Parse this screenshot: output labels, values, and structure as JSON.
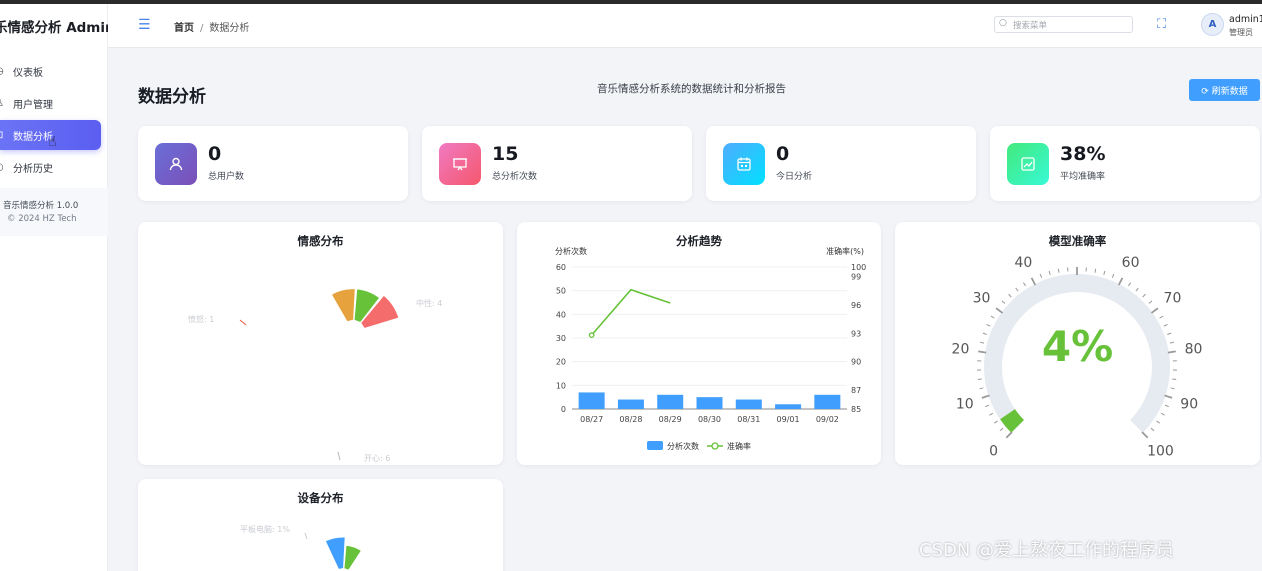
{
  "sidebar": {
    "brand": "乐情感分析 Admin",
    "items": [
      {
        "label": "仪表板",
        "icon": "dashboard-icon"
      },
      {
        "label": "用户管理",
        "icon": "user-icon"
      },
      {
        "label": "数据分析",
        "icon": "data-analysis-icon",
        "active": true
      },
      {
        "label": "分析历史",
        "icon": "history-icon"
      }
    ],
    "version": "音乐情感分析 1.0.0",
    "copyright": "© 2024 HZ Tech"
  },
  "header": {
    "breadcrumb_home": "首页",
    "breadcrumb_sep": "/",
    "breadcrumb_current": "数据分析",
    "search_placeholder": "搜索菜单",
    "user_name": "admin1",
    "user_role": "管理员",
    "avatar_letter": "A"
  },
  "page": {
    "title": "数据分析",
    "subtitle": "音乐情感分析系统的数据统计和分析报告",
    "refresh_label": "⟳ 刷新数据"
  },
  "stats": [
    {
      "value": "0",
      "label": "总用户数",
      "icon": "user-icon",
      "color_a": "#6a6fd8",
      "color_b": "#7b4fb8"
    },
    {
      "value": "15",
      "label": "总分析次数",
      "icon": "presentation-icon",
      "color_a": "#f07ac2",
      "color_b": "#f5576c"
    },
    {
      "value": "0",
      "label": "今日分析",
      "icon": "calendar-icon",
      "color_a": "#4facfe",
      "color_b": "#00e0fe"
    },
    {
      "value": "38%",
      "label": "平均准确率",
      "icon": "trend-icon",
      "color_a": "#43e97b",
      "color_b": "#38f9d7"
    }
  ],
  "panels": {
    "emotion": {
      "title": "情感分布",
      "ghost_labels": [
        "愤怒: 1",
        "中性: 4",
        "开心: 6"
      ]
    },
    "trend": {
      "title": "分析趋势"
    },
    "gauge": {
      "title": "模型准确率",
      "display": "4%"
    },
    "device": {
      "title": "设备分布",
      "ghost_labels": [
        "平板电脑: 1%"
      ]
    }
  },
  "chart_data": [
    {
      "type": "pie",
      "title": "情感分布",
      "slices": [
        {
          "name": "愤怒",
          "value": 1,
          "color": "#e8563c"
        },
        {
          "name": "中性",
          "value": 4,
          "color": "#67c23a"
        },
        {
          "name": "开心",
          "value": 6,
          "color": "#f56c6c"
        },
        {
          "name": "",
          "value": 4,
          "color": "#e6a23c"
        }
      ]
    },
    {
      "type": "bar",
      "title": "分析趋势",
      "categories": [
        "08/27",
        "08/28",
        "08/29",
        "08/30",
        "08/31",
        "09/01",
        "09/02"
      ],
      "series": [
        {
          "name": "分析次数",
          "type": "bar",
          "axis": "left",
          "color": "#409eff",
          "values": [
            7,
            4,
            6,
            5,
            4,
            2,
            6
          ]
        },
        {
          "name": "准确率",
          "type": "line",
          "axis": "right",
          "color": "#67c23a",
          "values": [
            92.8,
            97.6,
            96.2,
            null,
            null,
            null,
            null
          ]
        }
      ],
      "ylabel": "分析次数",
      "y2label": "准确率(%)",
      "ylim": [
        0,
        60
      ],
      "y2lim": [
        85,
        100
      ],
      "yticks": [
        0,
        10,
        20,
        30,
        40,
        50,
        60
      ],
      "y2ticks": [
        85,
        87,
        90,
        93,
        96,
        99,
        100
      ],
      "legend": "bottom"
    },
    {
      "type": "gauge",
      "title": "模型准确率",
      "value": 4,
      "min": 0,
      "max": 100,
      "ticks": [
        0,
        10,
        20,
        30,
        40,
        60,
        70,
        80,
        90,
        100
      ],
      "color": "#67c23a"
    },
    {
      "type": "pie",
      "title": "设备分布",
      "slices": [
        {
          "name": "",
          "value": 75,
          "color": "#409eff"
        },
        {
          "name": "",
          "value": 24,
          "color": "#67c23a"
        },
        {
          "name": "平板电脑",
          "value": 1,
          "color": "#e6a23c"
        }
      ]
    }
  ],
  "watermark": "CSDN @爱上熬夜工作的程序员"
}
